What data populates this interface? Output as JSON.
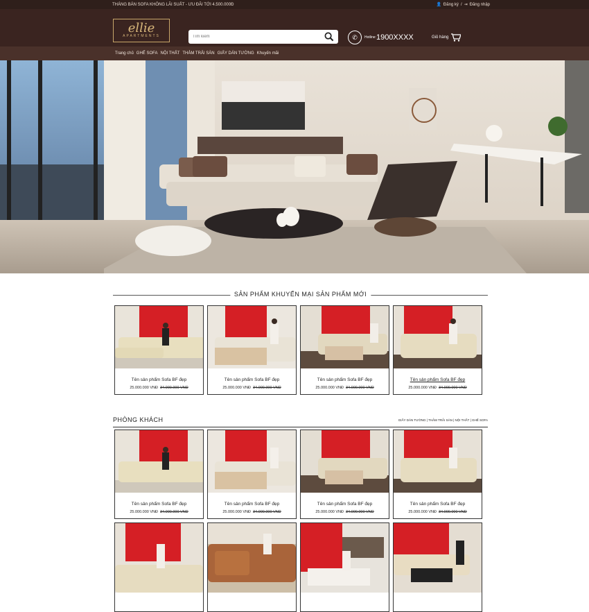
{
  "topbar": {
    "promo": "THÁNG BÁN SOFA KHÔNG LÃI SUẤT - ƯU ĐÃI TỚI 4.500.000Đ",
    "register": "Đăng ký",
    "login": "Đăng nhập"
  },
  "header": {
    "logo_main": "ellie",
    "logo_sub": "APARTMENTS",
    "search_placeholder": "Tìm kiếm",
    "hotline_label": "Hotline:",
    "hotline_number": "1900XXXX",
    "cart_label": "Giỏ hàng"
  },
  "nav": [
    "Trang chủ",
    "GHẾ SOFA",
    "NỘI THẤT",
    "THẢM TRẢI SÀN",
    "GIẤY DÁN TƯỜNG",
    "Khuyến mãi"
  ],
  "promo_section": {
    "title": "SẢN PHẨM KHUYẾN MẠI   SẢN PHẨM MỚI"
  },
  "products": [
    {
      "name": "Tên sản phẩm Sofa BF đẹp",
      "price": "25.000.000 VNĐ",
      "old_price": "34.000.000 VNĐ"
    },
    {
      "name": "Tên sản phẩm Sofa BF đẹp",
      "price": "25.000.000 VNĐ",
      "old_price": "34.000.000 VNĐ"
    },
    {
      "name": "Tên sản phẩm Sofa BF đẹp",
      "price": "25.000.000 VNĐ",
      "old_price": "34.000.000 VNĐ"
    },
    {
      "name": "Tên sản phẩm Sofa BF đẹp",
      "price": "25.000.000 VNĐ",
      "old_price": "34.000.000 VNĐ"
    }
  ],
  "living_room": {
    "title": "PHÒNG KHÁCH",
    "links": "GIẤY DÁN TƯỜNG | THẢM TRẢI SÀN | NỘI THẤT | GHẾ SOFA",
    "products": [
      {
        "name": "Tên sản phẩm Sofa BF đẹp",
        "price": "25.000.000 VNĐ",
        "old_price": "34.000.000 VNĐ"
      },
      {
        "name": "Tên sản phẩm Sofa BF đẹp",
        "price": "25.000.000 VNĐ",
        "old_price": "34.000.000 VNĐ"
      },
      {
        "name": "Tên sản phẩm Sofa BF đẹp",
        "price": "25.000.000 VNĐ",
        "old_price": "34.000.000 VNĐ"
      },
      {
        "name": "Tên sản phẩm Sofa BF đẹp",
        "price": "25.000.000 VNĐ",
        "old_price": "34.000.000 VNĐ"
      }
    ]
  },
  "colors": {
    "header_bg": "#3a2420",
    "accent_gold": "#c9a76a",
    "sofa_wall_red": "#d51f25"
  }
}
